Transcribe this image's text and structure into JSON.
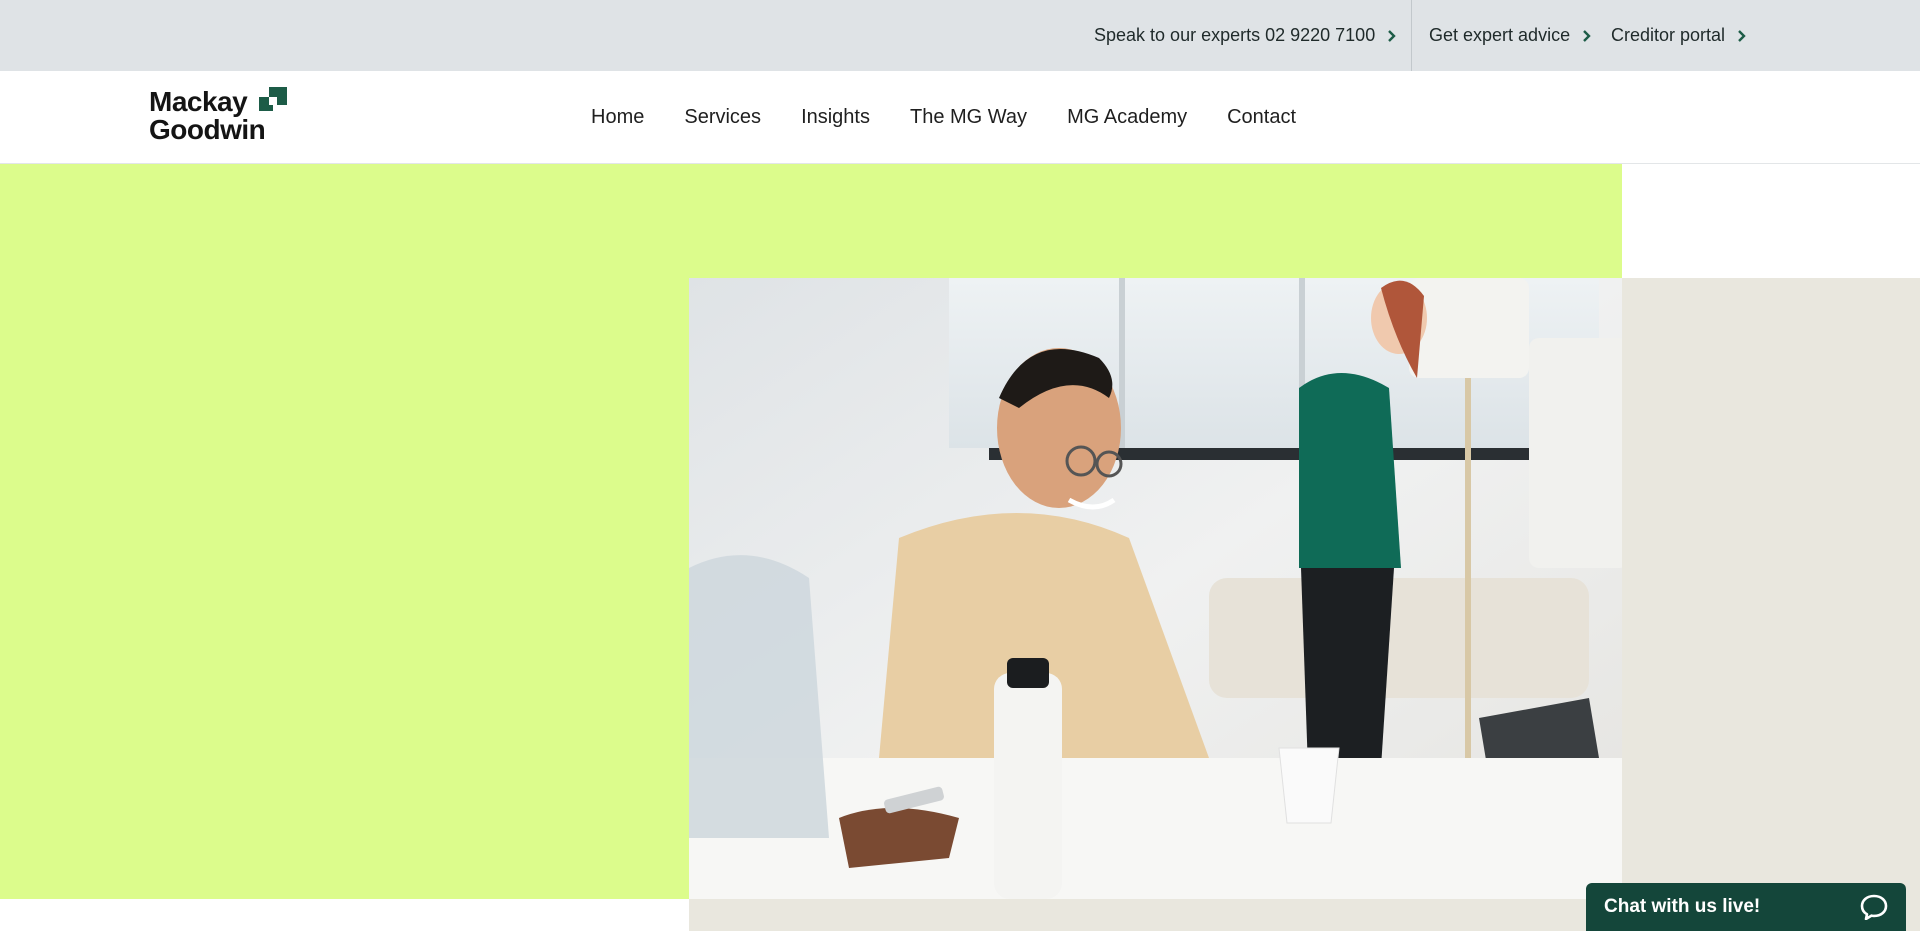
{
  "topbar": {
    "phone_link": "Speak to our experts 02 9220 7100",
    "advice_link": "Get expert advice",
    "creditor_link": "Creditor portal"
  },
  "brand": {
    "line1": "Mackay",
    "line2": "Goodwin",
    "accent_color": "#1d5c47"
  },
  "nav": {
    "items": [
      "Home",
      "Services",
      "Insights",
      "The MG Way",
      "MG Academy",
      "Contact"
    ]
  },
  "hero": {
    "green_color": "#dcfc8c",
    "beige_color": "#e9e7de"
  },
  "chat": {
    "label": "Chat with us live!",
    "icon": "chat-bubble-icon",
    "color": "#14463a"
  }
}
